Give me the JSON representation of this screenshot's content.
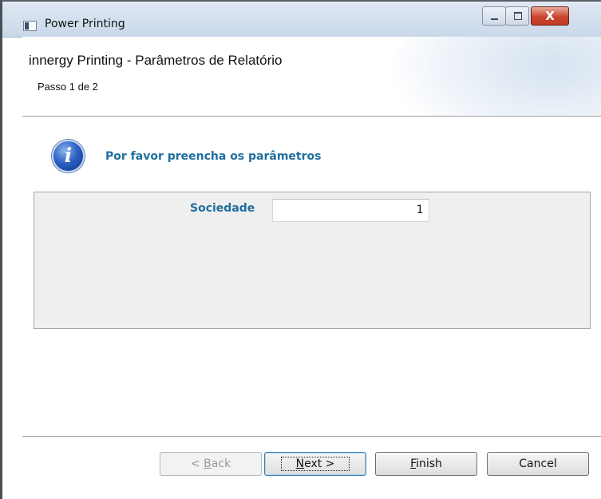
{
  "window": {
    "title": "Power Printing",
    "close_glyph": "X",
    "icon": "app-window-icon"
  },
  "header": {
    "title": "innergy Printing - Parâmetros de Relatório",
    "step": "Passo 1 de 2"
  },
  "info": {
    "icon": "information-icon",
    "glyph": "i",
    "message": "Por favor preencha os parâmetros"
  },
  "parameters": [
    {
      "label": "Sociedade",
      "value": "1"
    }
  ],
  "buttons": {
    "back": {
      "access_key": "B",
      "rest": "ack",
      "prefix": "< ",
      "enabled": false
    },
    "next": {
      "access_key": "N",
      "rest": "ext >"
    },
    "finish": {
      "access_key": "F",
      "rest": "inish"
    },
    "cancel": {
      "label": "Cancel"
    }
  },
  "colors": {
    "accent_text": "#1f6f9e",
    "close_button": "#c8462f"
  }
}
